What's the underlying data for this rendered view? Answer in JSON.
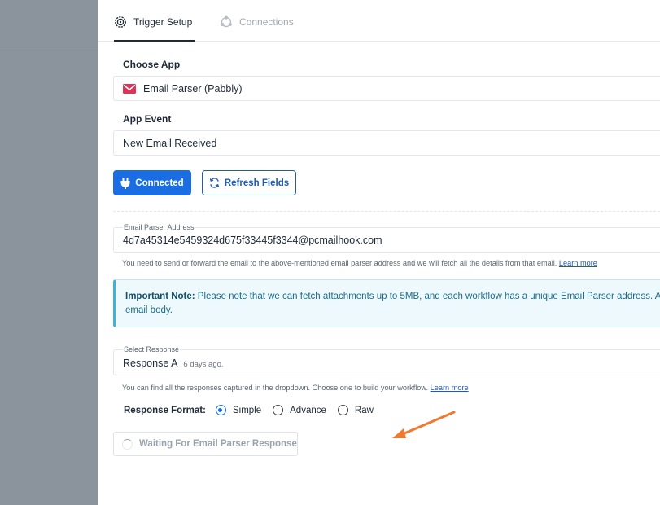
{
  "tabs": [
    {
      "label": "Trigger Setup",
      "icon": "gear-icon"
    },
    {
      "label": "Connections",
      "icon": "connections-icon"
    }
  ],
  "choose_app": {
    "label": "Choose App",
    "value": "Email Parser (Pabbly)",
    "icon": "envelope-icon",
    "icon_color": "#e0335a"
  },
  "app_event": {
    "label": "App Event",
    "value": "New Email Received"
  },
  "buttons": {
    "connected": "Connected",
    "refresh": "Refresh Fields"
  },
  "email_parser": {
    "label": "Email Parser Address",
    "value": "4d7a45314e5459324d675f33445f3344@pcmailhook.com",
    "hint": "You need to send or forward the email to the above-mentioned email parser address and we will fetch all the details from that email. ",
    "hint_link": "Learn more"
  },
  "note": {
    "title": "Important Note:",
    "line1": " Please note that we can fetch attachments up to 5MB, and each workflow has a unique Email Parser address. A",
    "line2": "email body."
  },
  "select_response": {
    "label": "Select Response",
    "value": "Response A",
    "meta": "6 days ago.",
    "hint": "You can find all the responses captured in the dropdown. Choose one to build your workflow. ",
    "hint_link": "Learn more"
  },
  "response_format": {
    "label": "Response Format:",
    "options": [
      "Simple",
      "Advance",
      "Raw"
    ],
    "selected": "Simple"
  },
  "waiting_button": "Waiting For Email Parser Response",
  "colors": {
    "primary": "#1a6de3",
    "note_accent": "#3fb2db",
    "arrow": "#f0782f"
  }
}
